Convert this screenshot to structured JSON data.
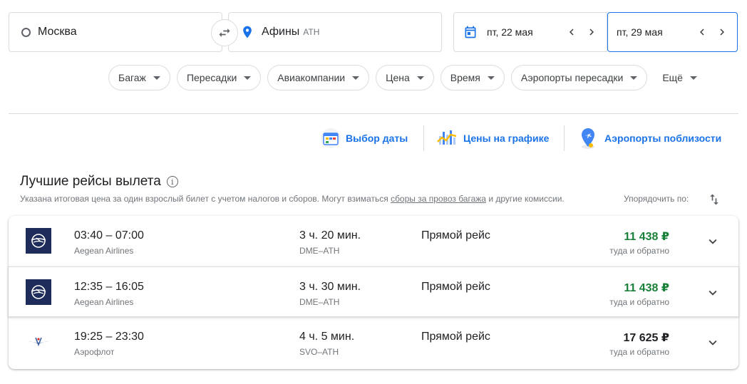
{
  "search": {
    "origin": "Москва",
    "destination": "Афины",
    "destination_code": "ATH",
    "depart_date": "пт, 22 мая",
    "return_date": "пт, 29 мая"
  },
  "filters": [
    "Багаж",
    "Пересадки",
    "Авиакомпании",
    "Цена",
    "Время",
    "Аэропорты пересадки",
    "Ещё"
  ],
  "tools": {
    "date_picker": "Выбор даты",
    "price_graph": "Цены на графике",
    "nearby_airports": "Аэропорты поблизости"
  },
  "results": {
    "title": "Лучшие рейсы вылета",
    "info_icon_glyph": "i",
    "note_before": "Указана итоговая цена за один взрослый билет с учетом налогов и сборов. Могут взиматься ",
    "note_link": "сборы за провоз багажа",
    "note_after": " и другие комиссии.",
    "sort_label": "Упорядочить по:"
  },
  "flights": [
    {
      "times": "03:40 – 07:00",
      "airline": "Aegean Airlines",
      "duration": "3 ч. 20 мин.",
      "route": "DME–ATH",
      "stops": "Прямой рейс",
      "price": "11 438 ₽",
      "price_type": "туда и обратно",
      "logo": "aegean-logo"
    },
    {
      "times": "12:35 – 16:05",
      "airline": "Aegean Airlines",
      "duration": "3 ч. 30 мин.",
      "route": "DME–ATH",
      "stops": "Прямой рейс",
      "price": "11 438 ₽",
      "price_type": "туда и обратно",
      "logo": "aegean-logo"
    },
    {
      "times": "19:25 – 23:30",
      "airline": "Аэрофлот",
      "duration": "4 ч. 5 мин.",
      "route": "SVO–ATH",
      "stops": "Прямой рейс",
      "price": "17 625 ₽",
      "price_type": "туда и обратно",
      "logo": "aeroflot-logo"
    }
  ],
  "colors": {
    "accent": "#1a73e8",
    "price_green": "#188038",
    "aegean_navy": "#1d2c5a",
    "aeroflot_blue": "#3c5f9e"
  }
}
